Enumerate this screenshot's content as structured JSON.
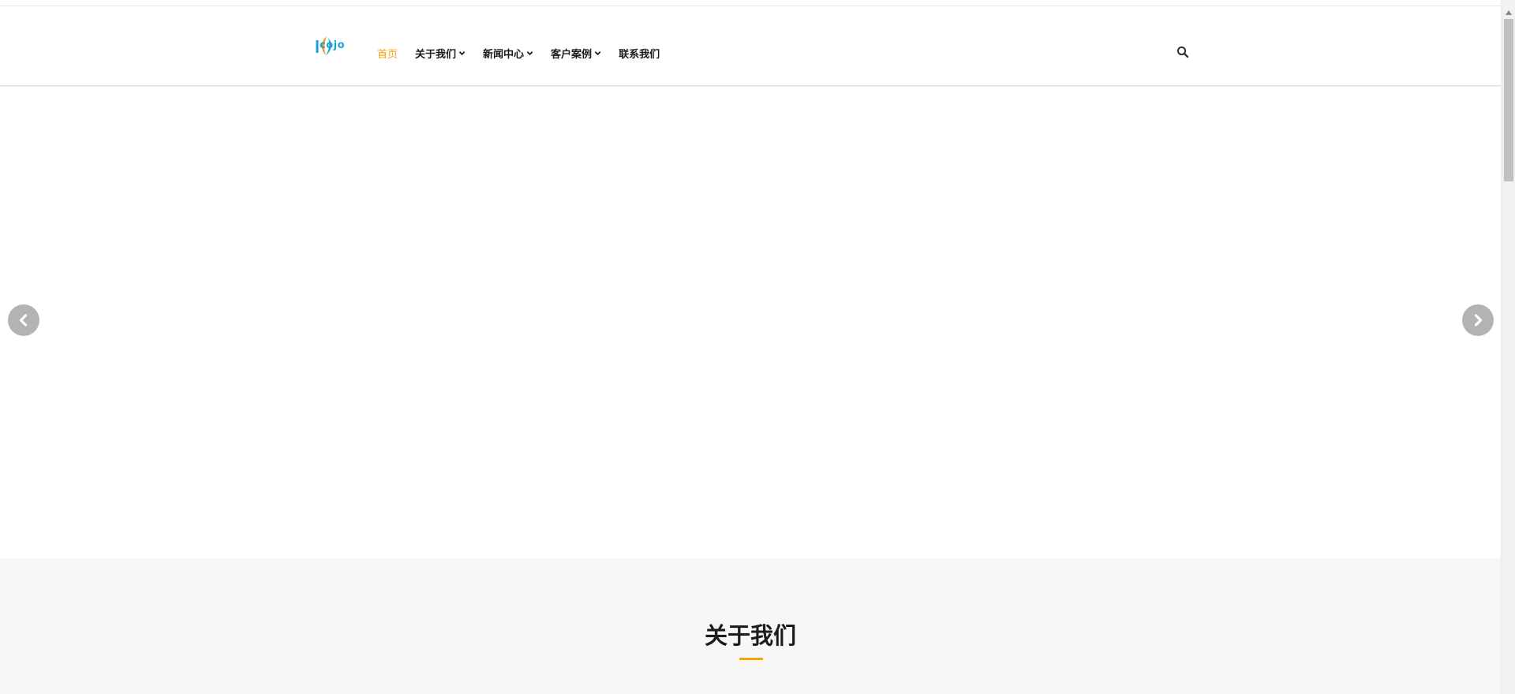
{
  "header": {
    "logo": {
      "text": "cojo",
      "icon": "leaf-logo-icon"
    },
    "nav": [
      {
        "label": "首页",
        "active": true,
        "has_dropdown": false
      },
      {
        "label": "关于我们",
        "active": false,
        "has_dropdown": true
      },
      {
        "label": "新闻中心",
        "active": false,
        "has_dropdown": true
      },
      {
        "label": "客户案例",
        "active": false,
        "has_dropdown": true
      },
      {
        "label": "联系我们",
        "active": false,
        "has_dropdown": false
      }
    ],
    "search_icon": "search-icon"
  },
  "slider": {
    "prev_icon": "chevron-left-icon",
    "next_icon": "chevron-right-icon"
  },
  "about": {
    "title": "关于我们"
  },
  "colors": {
    "accent": "#f0a40d",
    "logo_blue": "#1aa0d8",
    "logo_orange": "#f39a1f",
    "arrow_bg": "#b3b3b3"
  }
}
